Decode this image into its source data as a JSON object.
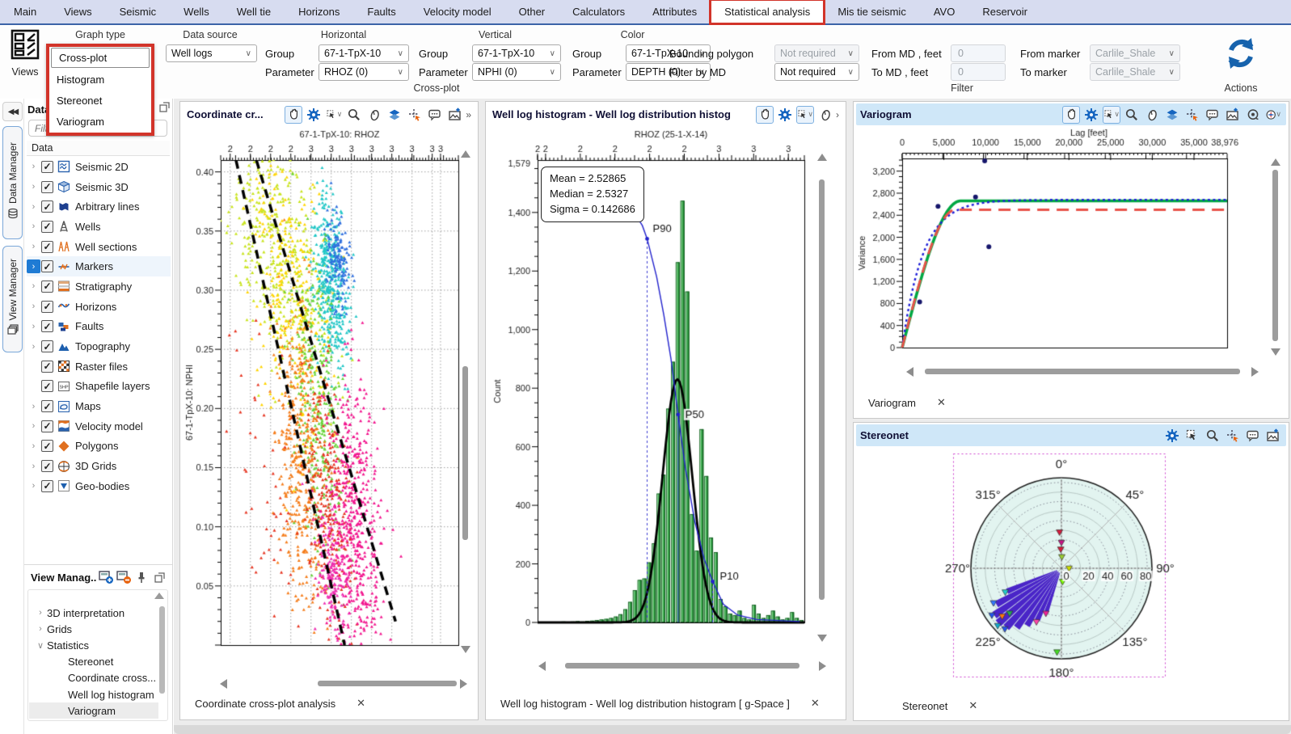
{
  "ribbon": {
    "tabs": [
      {
        "label": "Main"
      },
      {
        "label": "Views"
      },
      {
        "label": "Seismic"
      },
      {
        "label": "Wells"
      },
      {
        "label": "Well tie"
      },
      {
        "label": "Horizons"
      },
      {
        "label": "Faults"
      },
      {
        "label": "Velocity model"
      },
      {
        "label": "Other"
      },
      {
        "label": "Calculators"
      },
      {
        "label": "Attributes"
      },
      {
        "label": "Statistical analysis",
        "selected": true
      },
      {
        "label": "Mis tie seismic"
      },
      {
        "label": "AVO"
      },
      {
        "label": "Reservoir"
      }
    ]
  },
  "toolbar": {
    "views_label": "Views",
    "graph_type": {
      "caption": "Graph type",
      "options": [
        "Cross-plot",
        "Histogram",
        "Stereonet",
        "Variogram"
      ],
      "selected": "Cross-plot"
    },
    "data_source": {
      "caption": "Data source",
      "value": "Well logs"
    },
    "horizontal": {
      "caption": "Horizontal",
      "group_label": "Group",
      "group_value": "67-1-TpX-10",
      "param_label": "Parameter",
      "param_value": "RHOZ (0)"
    },
    "vertical": {
      "caption": "Vertical",
      "group_label": "Group",
      "group_value": "67-1-TpX-10",
      "param_label": "Parameter",
      "param_value": "NPHI (0)"
    },
    "color": {
      "caption": "Color",
      "group_label": "Group",
      "group_value": "67-1-TpX-10",
      "param_label": "Parameter",
      "param_value": "DEPTH (0)"
    },
    "filter": {
      "bounding_polygon_label": "Bounding polygon",
      "bounding_polygon_value": "Not required",
      "filter_by_md_label": "Filter by MD",
      "filter_by_md_value": "Not required",
      "from_md_label": "From MD , feet",
      "from_md_value": "0",
      "to_md_label": "To MD , feet",
      "to_md_value": "0",
      "from_marker_label": "From marker",
      "from_marker_value": "Carlile_Shale",
      "to_marker_label": "To marker",
      "to_marker_value": "Carlile_Shale"
    },
    "captions": {
      "cross_plot": "Cross-plot",
      "filter": "Filter",
      "actions": "Actions"
    }
  },
  "sidebar": {
    "tabs": [
      {
        "label": "Data Manager"
      },
      {
        "label": "View Manager"
      }
    ],
    "data_panel": {
      "title": "Data",
      "filter_placeholder": "Filter",
      "column_header": "Data",
      "items": [
        {
          "label": "Seismic 2D",
          "icon": "t-seis2d",
          "expandable": true,
          "checked": true
        },
        {
          "label": "Seismic 3D",
          "icon": "t-seis3d",
          "expandable": true,
          "checked": true
        },
        {
          "label": "Arbitrary lines",
          "icon": "t-arb",
          "expandable": true,
          "checked": true
        },
        {
          "label": "Wells",
          "icon": "t-wells",
          "expandable": true,
          "checked": true
        },
        {
          "label": "Well sections",
          "icon": "t-wellsec",
          "expandable": true,
          "checked": true
        },
        {
          "label": "Markers",
          "icon": "t-markers",
          "expandable": true,
          "checked": true,
          "selected": true
        },
        {
          "label": "Stratigraphy",
          "icon": "t-strat",
          "expandable": true,
          "checked": true
        },
        {
          "label": "Horizons",
          "icon": "t-horiz",
          "expandable": true,
          "checked": true
        },
        {
          "label": "Faults",
          "icon": "t-faults",
          "expandable": true,
          "checked": true
        },
        {
          "label": "Topography",
          "icon": "t-topo",
          "expandable": true,
          "checked": true
        },
        {
          "label": "Raster files",
          "icon": "t-raster",
          "expandable": false,
          "checked": true
        },
        {
          "label": "Shapefile layers",
          "icon": "t-shp",
          "expandable": false,
          "checked": true
        },
        {
          "label": "Maps",
          "icon": "t-maps",
          "expandable": true,
          "checked": true
        },
        {
          "label": "Velocity model",
          "icon": "t-vel",
          "expandable": true,
          "checked": true
        },
        {
          "label": "Polygons",
          "icon": "t-poly",
          "expandable": true,
          "checked": true
        },
        {
          "label": "3D Grids",
          "icon": "t-grids",
          "expandable": true,
          "checked": true
        },
        {
          "label": "Geo-bodies",
          "icon": "t-geo",
          "expandable": true,
          "checked": true
        }
      ]
    },
    "view_manager": {
      "title": "View Manag..",
      "items": [
        {
          "label": "3D interpretation",
          "level": 0,
          "chevron": "collapsed"
        },
        {
          "label": "Grids",
          "level": 0,
          "chevron": "collapsed"
        },
        {
          "label": "Statistics",
          "level": 0,
          "chevron": "expanded"
        },
        {
          "label": "Stereonet",
          "level": 1
        },
        {
          "label": "Coordinate cross...",
          "level": 1
        },
        {
          "label": "Well log histogram",
          "level": 1
        },
        {
          "label": "Variogram",
          "level": 1,
          "selected": true
        }
      ]
    }
  },
  "panels": {
    "crossplot": {
      "title": "Coordinate cr...",
      "tab_label": "Coordinate cross-plot analysis",
      "close_glyph": "✕"
    },
    "histogram": {
      "title": "Well log histogram - Well log distribution histogr...",
      "tab_label": "Well log histogram - Well log distribution histogram [ g-Space ]",
      "close_glyph": "✕",
      "tooltip": {
        "mean": "Mean = 2.52865",
        "median": "Median = 2.5327",
        "sigma": "Sigma = 0.142686"
      }
    },
    "variogram": {
      "title": "Variogram",
      "tab_label": "Variogram",
      "close_glyph": "✕"
    },
    "stereonet": {
      "title": "Stereonet",
      "tab_label": "Stereonet",
      "close_glyph": "✕"
    }
  },
  "chart_data": [
    {
      "id": "crossplot",
      "type": "scatter",
      "title": "67-1-TpX-10: RHOZ",
      "ylabel": "67-1-TpX-10: NPHI",
      "x_tick_labels": [
        "2",
        "2",
        "2",
        "2",
        "3",
        "3",
        "3",
        "3",
        "3",
        "3",
        "3",
        "3"
      ],
      "x_tick_fracs": [
        0.04,
        0.125,
        0.21,
        0.295,
        0.38,
        0.465,
        0.55,
        0.635,
        0.72,
        0.805,
        0.89,
        0.925
      ],
      "y_ticks": [
        0.05,
        0.1,
        0.15,
        0.2,
        0.25,
        0.3,
        0.35,
        0.4
      ],
      "xlim": [
        1.95,
        3.35
      ],
      "ylim": [
        0.0,
        0.41
      ],
      "grid": "dotted",
      "trend_lines": [
        {
          "x1": 2.04,
          "y1": 0.41,
          "x2": 2.68,
          "y2": 0.0
        },
        {
          "x1": 2.16,
          "y1": 0.41,
          "x2": 2.98,
          "y2": 0.02
        }
      ],
      "clusters": [
        {
          "color": "#c8e31c",
          "cx": 2.28,
          "cy": 0.335,
          "sx": 0.16,
          "sy": 0.045,
          "n": 420
        },
        {
          "color": "#ffd400",
          "cx": 2.35,
          "cy": 0.3,
          "sx": 0.12,
          "sy": 0.06,
          "n": 260
        },
        {
          "color": "#22c7c7",
          "cx": 2.6,
          "cy": 0.305,
          "sx": 0.05,
          "sy": 0.035,
          "n": 420
        },
        {
          "color": "#2f6fde",
          "cx": 2.64,
          "cy": 0.325,
          "sx": 0.035,
          "sy": 0.02,
          "n": 140
        },
        {
          "color": "#67d43a",
          "cx": 2.52,
          "cy": 0.205,
          "sx": 0.07,
          "sy": 0.06,
          "n": 300
        },
        {
          "color": "#f57d1b",
          "cx": 2.42,
          "cy": 0.16,
          "sx": 0.07,
          "sy": 0.06,
          "n": 420
        },
        {
          "color": "#e63420",
          "cx": 2.58,
          "cy": 0.12,
          "sx": 0.07,
          "sy": 0.05,
          "n": 260
        },
        {
          "color": "#f2158e",
          "cx": 2.74,
          "cy": 0.1,
          "sx": 0.08,
          "sy": 0.06,
          "n": 520
        },
        {
          "color": "#ee2bb0",
          "cx": 2.6,
          "cy": 0.06,
          "sx": 0.05,
          "sy": 0.025,
          "n": 160
        },
        {
          "color": "#e63420",
          "cx": 2.2,
          "cy": 0.14,
          "sx": 0.12,
          "sy": 0.05,
          "n": 50
        }
      ]
    },
    {
      "id": "histogram",
      "type": "bar",
      "title": "RHOZ (25-1-X-14)",
      "ylabel": "Count",
      "x_tick_labels": [
        "2",
        "2",
        "2",
        "2",
        "2",
        "2",
        "3",
        "3",
        "3"
      ],
      "x_tick_fracs": [
        0.0,
        0.03,
        0.16,
        0.29,
        0.42,
        0.55,
        0.68,
        0.81,
        0.94
      ],
      "y_ticks": [
        0,
        200,
        400,
        600,
        800,
        1000,
        1200,
        1400
      ],
      "y_max_label": "1,579",
      "xlim": [
        1.94,
        3.06
      ],
      "ylim": [
        0,
        1579
      ],
      "bin_start": 1.96,
      "bin_width": 0.02,
      "values": [
        0,
        2,
        1,
        2,
        3,
        2,
        3,
        4,
        3,
        5,
        6,
        8,
        10,
        12,
        15,
        20,
        28,
        45,
        70,
        110,
        145,
        150,
        205,
        270,
        440,
        505,
        730,
        890,
        1230,
        1440,
        1130,
        370,
        245,
        660,
        500,
        290,
        240,
        80,
        55,
        30,
        25,
        40,
        15,
        10,
        60,
        30,
        15,
        25,
        40,
        20,
        10,
        15,
        35,
        15,
        8
      ],
      "gauss": {
        "amp": 830,
        "mean": 2.527,
        "sigma": 0.062
      },
      "cumulative": [
        [
          1.96,
          1432
        ],
        [
          2.28,
          1428
        ],
        [
          2.34,
          1408
        ],
        [
          2.38,
          1355
        ],
        [
          2.4,
          1310
        ],
        [
          2.44,
          1180
        ],
        [
          2.47,
          1050
        ],
        [
          2.5,
          900
        ],
        [
          2.53,
          710
        ],
        [
          2.56,
          530
        ],
        [
          2.6,
          345
        ],
        [
          2.64,
          215
        ],
        [
          2.675,
          140
        ],
        [
          2.72,
          62
        ],
        [
          2.78,
          25
        ],
        [
          2.86,
          10
        ],
        [
          3.04,
          3
        ]
      ],
      "percentiles": {
        "P90": [
          2.4,
          1310
        ],
        "P50": [
          2.53,
          710
        ],
        "P10": [
          2.675,
          140
        ]
      }
    },
    {
      "id": "variogram",
      "type": "line",
      "xlabel": "Lag [feet]",
      "ylabel": "Variance",
      "x_ticks": [
        0,
        5000,
        10000,
        15000,
        20000,
        25000,
        30000,
        35000
      ],
      "x_end_label": "38,976",
      "y_ticks": [
        0,
        400,
        800,
        1200,
        1600,
        2000,
        2400,
        2800,
        3200
      ],
      "xlim": [
        0,
        38976
      ],
      "ylim": [
        0,
        3430
      ],
      "series": [
        {
          "name": "experimental-points",
          "kind": "points",
          "color": "#16166b",
          "points": [
            [
              2100,
              830
            ],
            [
              4300,
              2560
            ],
            [
              8800,
              2730
            ],
            [
              10400,
              1830
            ],
            [
              9900,
              3430
            ]
          ]
        },
        {
          "name": "model-green",
          "kind": "model",
          "style": "solid",
          "color": "#00a843",
          "model": "spherical",
          "range": 7000,
          "sill": 2660
        },
        {
          "name": "model-blue",
          "kind": "model",
          "style": "dotted",
          "color": "#1f1fd8",
          "model": "exponential",
          "range": 7500,
          "sill": 2680
        },
        {
          "name": "model-red",
          "kind": "model",
          "style": "dashed",
          "color": "#e8534a",
          "model": "spherical",
          "range": 6400,
          "sill": 2500
        }
      ]
    },
    {
      "id": "stereonet",
      "type": "polar",
      "azimuth_labels": [
        "0°",
        "45°",
        "90°",
        "135°",
        "180°",
        "225°",
        "270°",
        "315°"
      ],
      "radial_labels": [
        "0",
        "20",
        "40",
        "60",
        "80"
      ],
      "r_max": 95,
      "fan_color": "#4a25c8",
      "fan_sectors": [
        {
          "az": 199,
          "r": 48
        },
        {
          "az": 205,
          "r": 60
        },
        {
          "az": 211,
          "r": 70
        },
        {
          "az": 217,
          "r": 78
        },
        {
          "az": 223,
          "r": 85
        },
        {
          "az": 229,
          "r": 88
        },
        {
          "az": 235,
          "r": 86
        },
        {
          "az": 241,
          "r": 78
        },
        {
          "az": 247,
          "r": 62
        }
      ],
      "markers": [
        {
          "az": 357,
          "r": 38,
          "color": "#d81b3c"
        },
        {
          "az": 358,
          "r": 20,
          "color": "#d81b3c"
        },
        {
          "az": 0,
          "r": 27,
          "color": "#c71585"
        },
        {
          "az": 2,
          "r": 12,
          "color": "#9acd32"
        },
        {
          "az": 90,
          "r": 8,
          "color": "#ccdd00"
        },
        {
          "az": 175,
          "r": 14,
          "color": "#7cfc00"
        },
        {
          "az": 183,
          "r": 88,
          "color": "#44dd22"
        },
        {
          "az": 199,
          "r": 50,
          "color": "#ee2299"
        },
        {
          "az": 205,
          "r": 62,
          "color": "#ff44aa"
        },
        {
          "az": 223,
          "r": 87,
          "color": "#2255ee"
        },
        {
          "az": 228,
          "r": 90,
          "color": "#11aacc"
        },
        {
          "az": 231,
          "r": 80,
          "color": "#ff7711"
        },
        {
          "az": 236,
          "r": 88,
          "color": "#2255ee"
        },
        {
          "az": 243,
          "r": 80,
          "color": "#3377ff"
        },
        {
          "az": 247,
          "r": 64,
          "color": "#22cccc"
        },
        {
          "az": 229,
          "r": 72,
          "color": "#22aa55"
        }
      ]
    }
  ]
}
